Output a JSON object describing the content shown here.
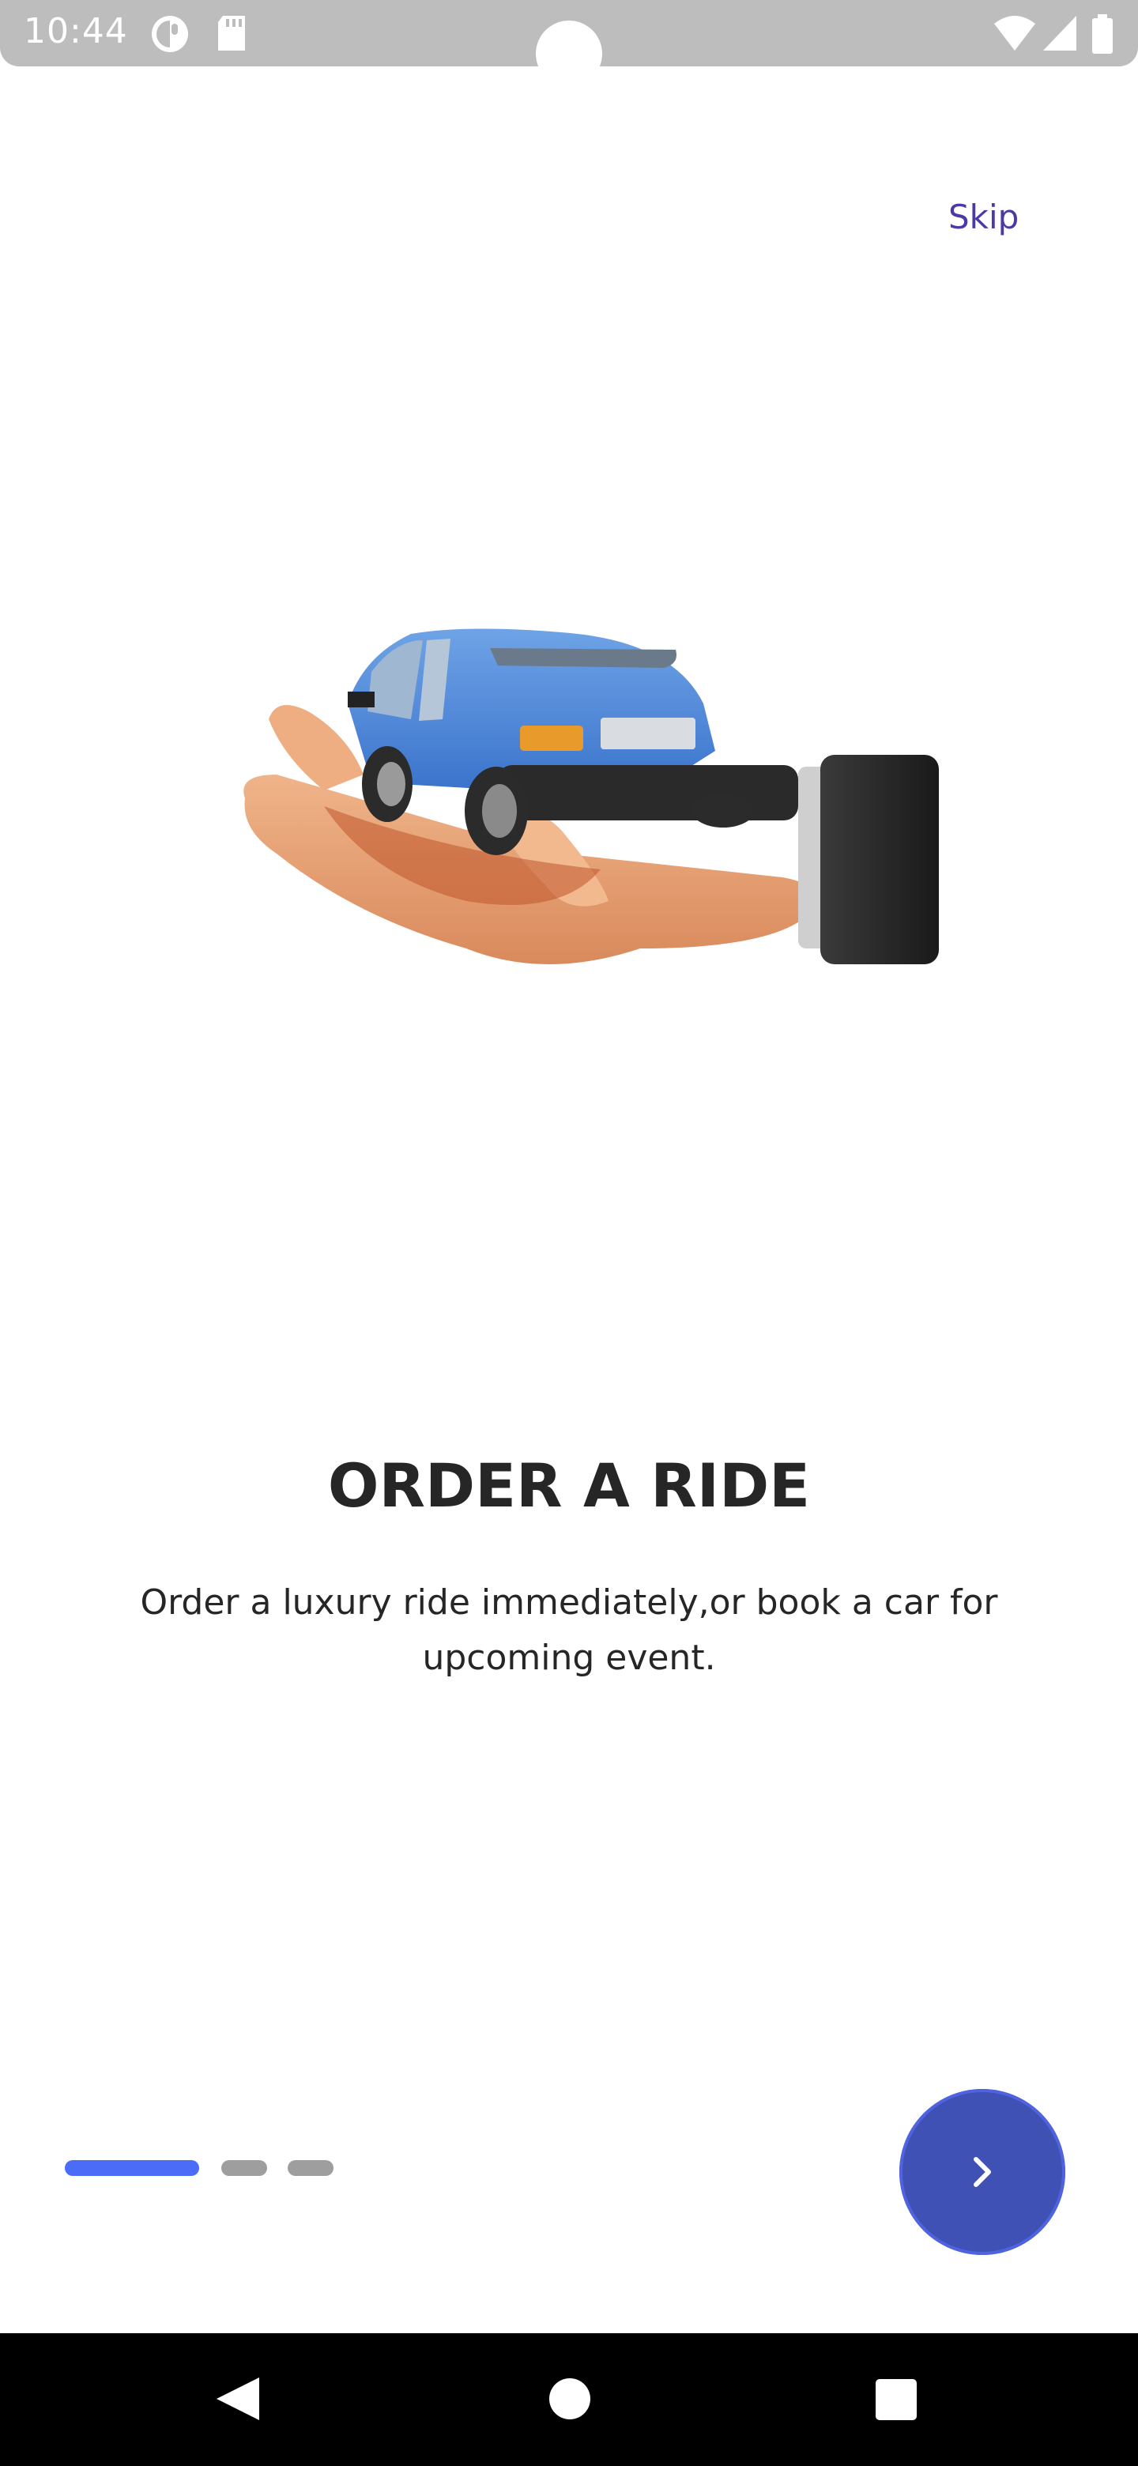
{
  "status_bar": {
    "time": "10:44"
  },
  "onboarding": {
    "skip_label": "Skip",
    "title": "ORDER A RIDE",
    "description": "Order a luxury ride immediately,or book a car for upcoming event.",
    "page_count": 3,
    "current_page": 1,
    "next_icon": "chevron-right-icon"
  },
  "colors": {
    "accent": "#3f51b5",
    "indicator_active": "#4a6cf7",
    "indicator_inactive": "#9e9e9e",
    "skip": "#4a3aa8",
    "text": "#262626"
  },
  "nav_bar": {
    "icons": [
      "back-icon",
      "home-icon",
      "recents-icon"
    ]
  }
}
